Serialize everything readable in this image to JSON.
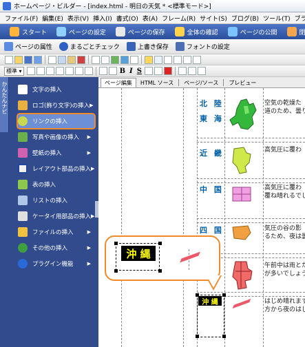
{
  "titlebar": {
    "text": "ホームページ・ビルダー - [index.html - 明日の天気 * <標準モード>]"
  },
  "menubar": {
    "items": [
      "ファイル(F)",
      "編集(E)",
      "表示(V)",
      "挿入(I)",
      "書式(O)",
      "表(A)",
      "フレーム(R)",
      "サイト(S)",
      "ブログ(B)",
      "ツール(T)",
      "ブラ"
    ]
  },
  "navbar": {
    "items": [
      "スタート",
      "ページの設定",
      "ページの保存",
      "全体の確認",
      "ページの公開",
      "閉じる"
    ]
  },
  "toolbar1": {
    "items": [
      "ページの属性",
      "まるごとチェック",
      "上書き保存",
      "フォントの設定"
    ]
  },
  "toolbar3": {
    "style_select": "標準"
  },
  "sidebar": {
    "tab_label": "かんたんナビ",
    "items": [
      {
        "label": "文字の挿入",
        "arrow": ""
      },
      {
        "label": "ロゴ(飾り文字)の挿入",
        "arrow": "▶"
      },
      {
        "label": "リンクの挿入",
        "arrow": ""
      },
      {
        "label": "写真や画像の挿入",
        "arrow": "▶"
      },
      {
        "label": "壁紙の挿入",
        "arrow": "▶"
      },
      {
        "label": "レイアウト部品の挿入",
        "arrow": "▶"
      },
      {
        "label": "表の挿入",
        "arrow": ""
      },
      {
        "label": "リストの挿入",
        "arrow": ""
      },
      {
        "label": "ケータイ用部品の挿入",
        "arrow": "▶"
      },
      {
        "label": "ファイルの挿入",
        "arrow": "▶"
      },
      {
        "label": "その他の挿入",
        "arrow": "▶"
      },
      {
        "label": "プラグイン機能",
        "arrow": "▶"
      }
    ]
  },
  "editor": {
    "tabs": [
      "ページ編集",
      "HTML ソース",
      "ページ/ソース",
      "プレビュー"
    ],
    "regions": [
      {
        "name": "北 陸",
        "text1": "空気の乾燥た",
        "text2": "道のため、曇り"
      },
      {
        "name": "東 海",
        "text1": "",
        "text2": ""
      },
      {
        "name": "近 畿",
        "text1": "高気圧に覆わ",
        "text2": ""
      },
      {
        "name": "中 国",
        "text1": "高気圧に覆わ",
        "text2": "覆ね晴れるでし"
      },
      {
        "name": "四 国",
        "text1": "気圧の谷の影",
        "text2": "るため、夜は曇"
      },
      {
        "name": "",
        "text1": "午前中は雨とた",
        "text2": "が多いでしょう"
      },
      {
        "name": "沖 縄",
        "text1": "はじめ晴れます",
        "text2": "方から夜のはじ"
      }
    ],
    "okinawa_block": "沖 縄",
    "callout_block": "沖 縄"
  },
  "colors": {
    "accent": "#f08a2a",
    "sidebar": "#314b8d",
    "navbar": "#2b4f9c",
    "region": "#005fa8"
  }
}
